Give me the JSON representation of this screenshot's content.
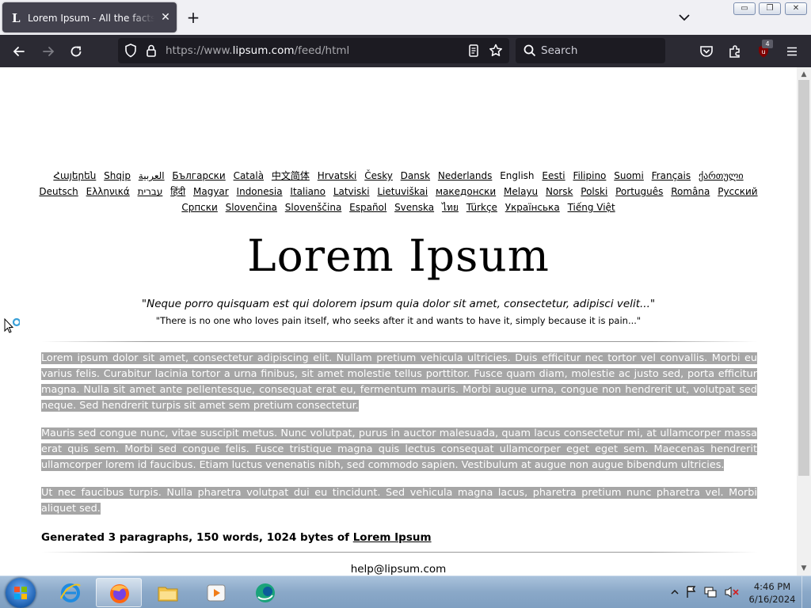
{
  "browser": {
    "tab": {
      "title": "Lorem Ipsum - All the facts - Lipsum generator",
      "favicon": "L",
      "close": "✕"
    },
    "new_tab": "+",
    "url": {
      "prefix": "https://www.",
      "host": "lipsum.com",
      "path": "/feed/html"
    },
    "search_placeholder": "Search",
    "extension_badge": "4"
  },
  "page": {
    "languages": [
      {
        "label": "Հայերեն",
        "link": true
      },
      {
        "label": "Shqip",
        "link": true
      },
      {
        "label": "العربية",
        "link": true
      },
      {
        "label": "Български",
        "link": true
      },
      {
        "label": "Català",
        "link": true
      },
      {
        "label": "中文简体",
        "link": true
      },
      {
        "label": "Hrvatski",
        "link": true
      },
      {
        "label": "Česky",
        "link": true
      },
      {
        "label": "Dansk",
        "link": true
      },
      {
        "label": "Nederlands",
        "link": true
      },
      {
        "label": "English",
        "link": false
      },
      {
        "label": "Eesti",
        "link": true
      },
      {
        "label": "Filipino",
        "link": true
      },
      {
        "label": "Suomi",
        "link": true
      },
      {
        "label": "Français",
        "link": true
      },
      {
        "label": "ქართული",
        "link": true
      },
      {
        "label": "Deutsch",
        "link": true
      },
      {
        "label": "Ελληνικά",
        "link": true
      },
      {
        "label": "עברית",
        "link": true
      },
      {
        "label": "हिंदी",
        "link": true
      },
      {
        "label": "Magyar",
        "link": true
      },
      {
        "label": "Indonesia",
        "link": true
      },
      {
        "label": "Italiano",
        "link": true
      },
      {
        "label": "Latviski",
        "link": true
      },
      {
        "label": "Lietuviškai",
        "link": true
      },
      {
        "label": "македонски",
        "link": true
      },
      {
        "label": "Melayu",
        "link": true
      },
      {
        "label": "Norsk",
        "link": true
      },
      {
        "label": "Polski",
        "link": true
      },
      {
        "label": "Português",
        "link": true
      },
      {
        "label": "Româna",
        "link": true
      },
      {
        "label": "Pyccкий",
        "link": true
      },
      {
        "label": "Српски",
        "link": true
      },
      {
        "label": "Slovenčina",
        "link": true
      },
      {
        "label": "Slovenščina",
        "link": true
      },
      {
        "label": "Español",
        "link": true
      },
      {
        "label": "Svenska",
        "link": true
      },
      {
        "label": "ไทย",
        "link": true
      },
      {
        "label": "Türkçe",
        "link": true
      },
      {
        "label": "Українська",
        "link": true
      },
      {
        "label": "Tiếng Việt",
        "link": true
      }
    ],
    "logo": "Lorem Ipsum",
    "quote_latin": "\"Neque porro quisquam est qui dolorem ipsum quia dolor sit amet, consectetur, adipisci velit...\"",
    "quote_english": "\"There is no one who loves pain itself, who seeks after it and wants to have it, simply because it is pain...\"",
    "paragraphs": [
      "Lorem ipsum dolor sit amet, consectetur adipiscing elit. Nullam pretium vehicula ultricies. Duis efficitur nec tortor vel convallis. Morbi eu varius felis. Curabitur lacinia tortor a urna finibus, sit amet molestie tellus porttitor. Fusce quam diam, molestie ac justo sed, porta efficitur magna. Nulla sit amet ante pellentesque, consequat erat eu, fermentum mauris. Morbi augue urna, congue non hendrerit ut, volutpat sed neque. Sed hendrerit turpis sit amet sem pretium consectetur.",
      "Mauris sed congue nunc, vitae suscipit metus. Nunc volutpat, purus in auctor malesuada, quam lacus consectetur mi, at ullamcorper massa erat quis sem. Morbi sed congue felis. Fusce tristique magna quis lectus consequat ullamcorper eget eget sem. Maecenas hendrerit ullamcorper lorem id faucibus. Etiam luctus venenatis nibh, sed commodo sapien. Vestibulum at augue non augue bibendum ultricies.",
      "Ut nec faucibus turpis. Nulla pharetra volutpat dui eu tincidunt. Sed vehicula magna lacus, pharetra pretium nunc pharetra vel. Morbi aliquet sed."
    ],
    "generated_prefix": "Generated 3 paragraphs, 150 words, 1024 bytes of ",
    "generated_link": "Lorem Ipsum",
    "email": "help@lipsum.com"
  },
  "taskbar": {
    "apps": [
      {
        "name": "internet-explorer-icon",
        "active": false
      },
      {
        "name": "firefox-icon",
        "active": true
      },
      {
        "name": "file-explorer-icon",
        "active": false
      },
      {
        "name": "media-player-icon",
        "active": false
      },
      {
        "name": "app-icon",
        "active": false
      }
    ],
    "time": "4:46 PM",
    "date": "6/16/2024"
  },
  "colors": {
    "tab_bg": "#42414d",
    "toolbar_bg": "#2b2a33",
    "urlbar_bg": "#1c1b22",
    "selection": "#a6a6a6"
  }
}
